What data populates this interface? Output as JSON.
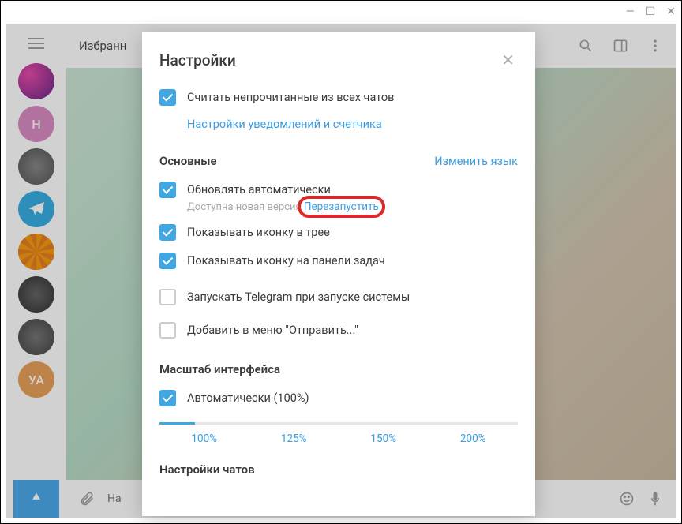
{
  "window": {
    "chat_title": "Избранн",
    "input_placeholder": "На"
  },
  "dialog": {
    "title": "Настройки",
    "unread_label": "Считать непрочитанные из всех чатов",
    "notif_link": "Настройки уведомлений и счетчика",
    "main_section": "Основные",
    "change_lang": "Изменить язык",
    "auto_update": "Обновлять автоматически",
    "new_version": "Доступна новая версия",
    "restart": "Перезапустить",
    "tray_icon": "Показывать иконку в трее",
    "taskbar_icon": "Показывать иконку на панели задач",
    "autostart": "Запускать Telegram при запуске системы",
    "sendto": "Добавить в меню \"Отправить...\"",
    "scale_section": "Масштаб интерфейса",
    "scale_auto": "Автоматически (100%)",
    "scale_100": "100%",
    "scale_125": "125%",
    "scale_150": "150%",
    "scale_200": "200%",
    "chat_section": "Настройки чатов"
  },
  "avatars": [
    {
      "bg": "radial-gradient(circle at 30% 30%, #e84aa8, #6a2a88)"
    },
    {
      "bg": "#d98cc4",
      "letter": "Н"
    },
    {
      "bg": "radial-gradient(circle, #888, #555)"
    },
    {
      "bg": "#37aee2",
      "telegram": true
    },
    {
      "bg": "radial-gradient(circle, #f5a623, #e67e22)",
      "orange": true
    },
    {
      "bg": "radial-gradient(circle, #666, #333)"
    },
    {
      "bg": "radial-gradient(circle, #777, #444)"
    },
    {
      "bg": "#e8a05a",
      "letter": "УА"
    }
  ]
}
